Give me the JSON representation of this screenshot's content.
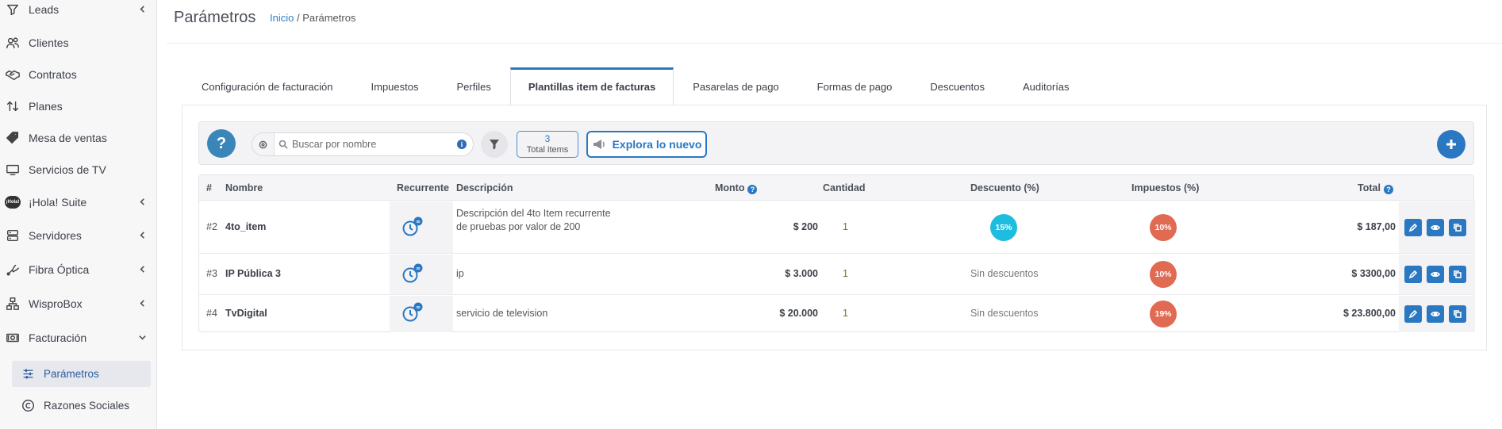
{
  "sidebar": {
    "items": [
      {
        "label": "Leads",
        "icon": "funnel-icon"
      },
      {
        "label": "Clientes",
        "icon": "users-icon"
      },
      {
        "label": "Contratos",
        "icon": "handshake-icon"
      },
      {
        "label": "Planes",
        "icon": "arrows-updown-icon"
      },
      {
        "label": "Mesa de ventas",
        "icon": "tag-icon"
      },
      {
        "label": "Servicios de TV",
        "icon": "tv-icon"
      },
      {
        "label": "¡Hola! Suite",
        "icon": "hola-logo-icon",
        "logo_text": "¡Hola!"
      },
      {
        "label": "Servidores",
        "icon": "server-icon"
      },
      {
        "label": "Fibra Óptica",
        "icon": "fiber-icon"
      },
      {
        "label": "WisproBox",
        "icon": "network-icon"
      },
      {
        "label": "Facturación",
        "icon": "money-icon"
      }
    ],
    "sub_items": [
      {
        "label": "Parámetros",
        "icon": "sliders-icon",
        "active": true
      },
      {
        "label": "Razones Sociales",
        "icon": "copyright-icon",
        "active": false
      }
    ]
  },
  "header": {
    "title": "Parámetros",
    "breadcrumb_home": "Inicio",
    "breadcrumb_sep": "/",
    "breadcrumb_current": "Parámetros"
  },
  "tabs": [
    {
      "label": "Configuración de facturación"
    },
    {
      "label": "Impuestos"
    },
    {
      "label": "Perfiles"
    },
    {
      "label": "Plantillas item de facturas",
      "active": true
    },
    {
      "label": "Pasarelas de pago"
    },
    {
      "label": "Formas de pago"
    },
    {
      "label": "Descuentos"
    },
    {
      "label": "Auditorías"
    }
  ],
  "toolbar": {
    "help_label": "?",
    "search_placeholder": "Buscar por nombre",
    "info_label": "i",
    "total_count": "3",
    "total_label": "Total items",
    "explore_label": "Explora lo nuevo",
    "accent_color": "#2a78c2"
  },
  "table": {
    "columns": {
      "index": "#",
      "name": "Nombre",
      "recurring": "Recurrente",
      "description": "Descripción",
      "amount": "Monto",
      "quantity": "Cantidad",
      "discount": "Descuento (%)",
      "taxes": "Impuestos (%)",
      "total": "Total"
    },
    "rows": [
      {
        "index": "#2",
        "name": "4to_item",
        "description": "Descripción del 4to Item recurrente de pruebas por valor de 200",
        "amount": "$ 200",
        "quantity": "1",
        "discount": "15%",
        "discount_is_badge": true,
        "tax": "10%",
        "total": "$ 187,00"
      },
      {
        "index": "#3",
        "name": "IP Pública 3",
        "description": "ip",
        "amount": "$ 3.000",
        "quantity": "1",
        "discount": "Sin descuentos",
        "discount_is_badge": false,
        "tax": "10%",
        "total": "$ 3300,00"
      },
      {
        "index": "#4",
        "name": "TvDigital",
        "description": "servicio de television",
        "amount": "$ 20.000",
        "quantity": "1",
        "discount": "Sin descuentos",
        "discount_is_badge": false,
        "tax": "19%",
        "total": "$ 23.800,00"
      }
    ],
    "colors": {
      "discount_badge": "#1ebde0",
      "tax_badge": "#e06a52",
      "action_button": "#2a78c2"
    }
  }
}
